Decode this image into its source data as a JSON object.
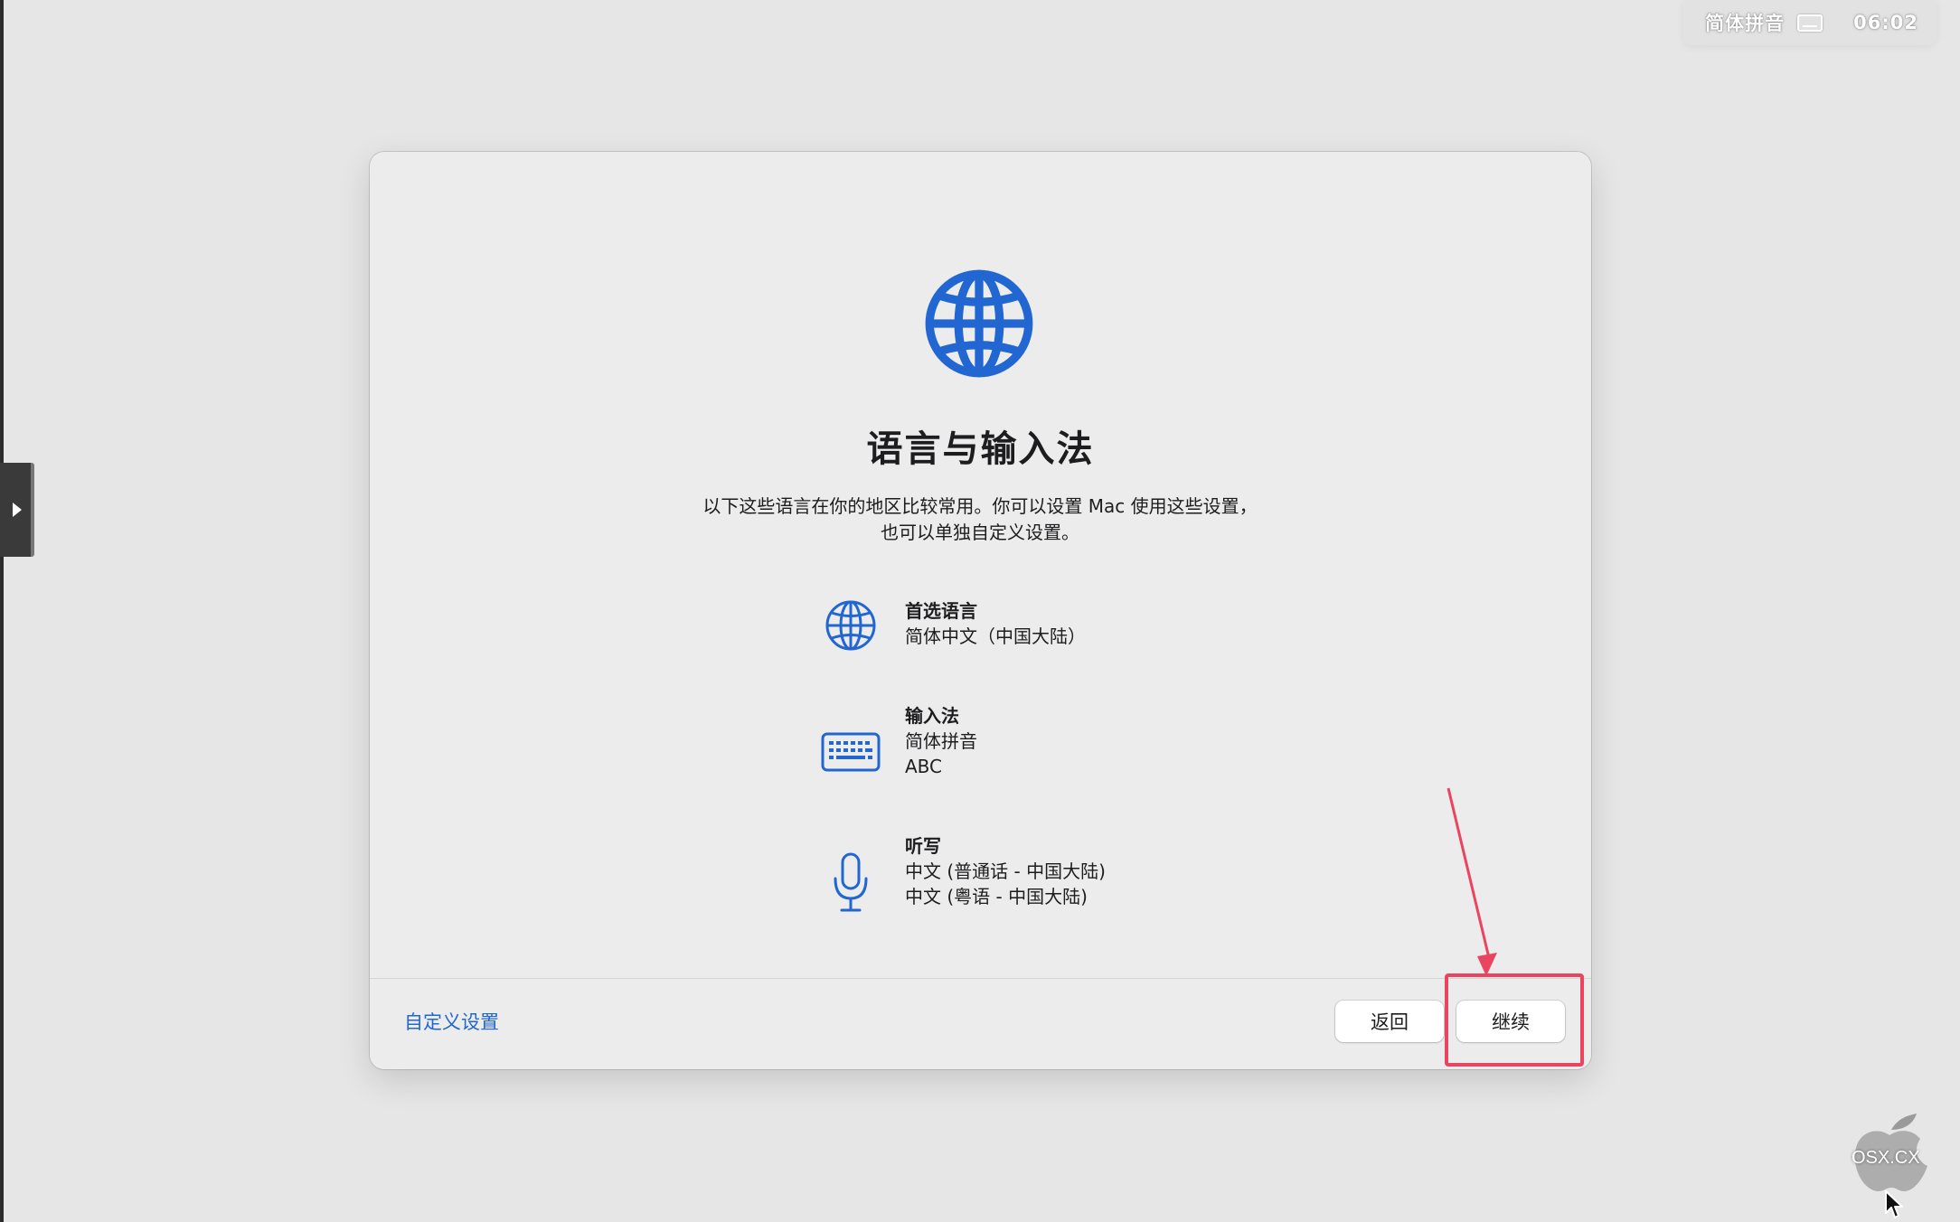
{
  "menubar": {
    "input_method": "简体拼音",
    "time": "06:02"
  },
  "dialog": {
    "title": "语言与输入法",
    "description_line1": "以下这些语言在你的地区比较常用。你可以设置 Mac 使用这些设置，",
    "description_line2": "也可以单独自定义设置。",
    "preferred_language": {
      "heading": "首选语言",
      "values": [
        "简体中文（中国大陆）"
      ]
    },
    "input_sources": {
      "heading": "输入法",
      "values": [
        "简体拼音",
        "ABC"
      ]
    },
    "dictation": {
      "heading": "听写",
      "values": [
        "中文 (普通话 - 中国大陆)",
        "中文 (粤语 - 中国大陆)"
      ]
    },
    "footer": {
      "customize_label": "自定义设置",
      "back_label": "返回",
      "continue_label": "继续"
    }
  },
  "watermark": {
    "text": "OSX.CX"
  },
  "colors": {
    "accent": "#2166d1",
    "annotation": "#ea4560",
    "background": "#e6e6e6",
    "panel": "#ececec"
  },
  "icons": {
    "hero": "globe-icon",
    "preferred_language": "globe-icon",
    "input_sources": "keyboard-icon",
    "dictation": "microphone-icon",
    "menubar_input": "keyboard-icon",
    "side_tab": "play-triangle-icon"
  }
}
